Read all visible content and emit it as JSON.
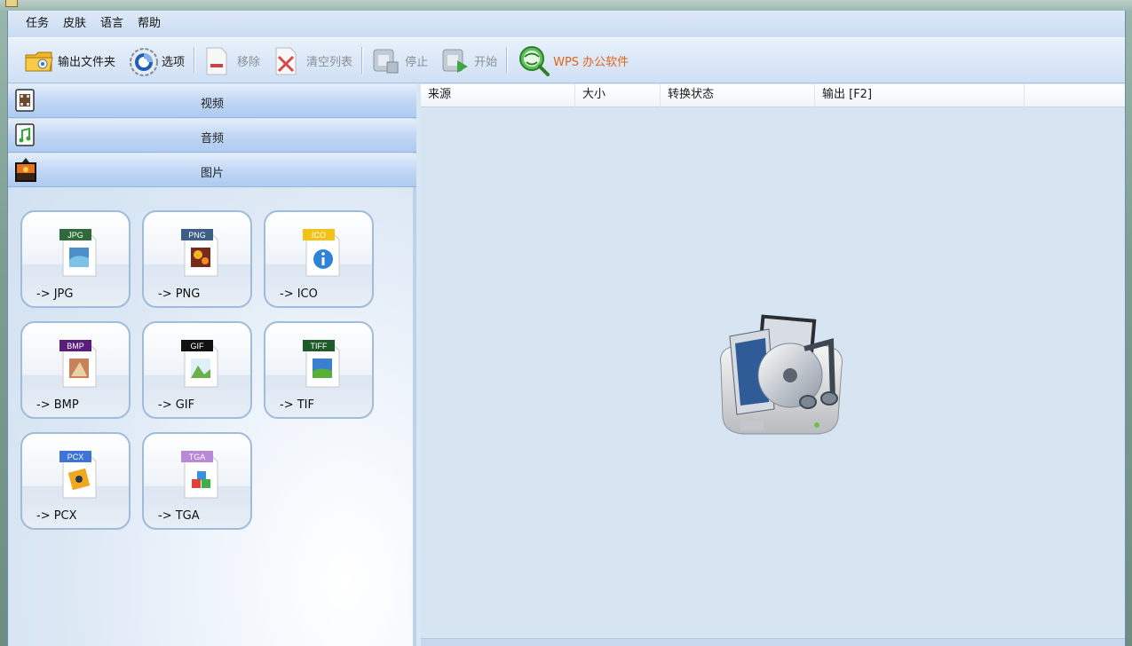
{
  "menu": {
    "items": [
      "任务",
      "皮肤",
      "语言",
      "帮助"
    ]
  },
  "toolbar": {
    "output_folder": "输出文件夹",
    "options": "选项",
    "remove": "移除",
    "clear_list": "清空列表",
    "stop": "停止",
    "start": "开始",
    "wps": "WPS 办公软件"
  },
  "categories": {
    "video": "视频",
    "audio": "音频",
    "picture": "图片"
  },
  "formats": [
    {
      "badge": "JPG",
      "label": "-> JPG",
      "badge_color": "#2f6b3a"
    },
    {
      "badge": "PNG",
      "label": "-> PNG",
      "badge_color": "#3d5f86"
    },
    {
      "badge": "ICO",
      "label": "-> ICO",
      "badge_color": "#f2c218"
    },
    {
      "badge": "BMP",
      "label": "-> BMP",
      "badge_color": "#5a1e7a"
    },
    {
      "badge": "GIF",
      "label": "-> GIF",
      "badge_color": "#111111"
    },
    {
      "badge": "TIFF",
      "label": "-> TIF",
      "badge_color": "#1f5a2a"
    },
    {
      "badge": "PCX",
      "label": "-> PCX",
      "badge_color": "#3f73d6"
    },
    {
      "badge": "TGA",
      "label": "-> TGA",
      "badge_color": "#b88ad6"
    }
  ],
  "list": {
    "columns": [
      "来源",
      "大小",
      "转换状态",
      "输出 [F2]"
    ]
  },
  "colors": {
    "accent": "#aecbf1",
    "wps": "#e0651b",
    "body_bg": "#d7e4f2"
  }
}
